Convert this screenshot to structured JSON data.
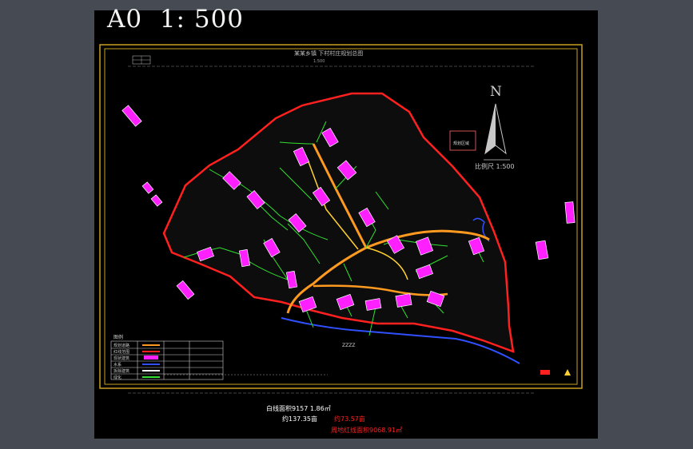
{
  "drawing": {
    "scale_title": "A0  1: 500",
    "plan_title": "某某乡镇 下村村庄规划总图",
    "plan_subtitle": "1:500",
    "north_letter": "N",
    "scale_bar_label": "比例尺 1:500",
    "inset_label": "规划区域",
    "road_label": "ZZZZ",
    "stats": {
      "total_area": "白线面积9157 1.86㎡",
      "total_mu": "约137.35亩",
      "red_mu": "约73.57亩",
      "red_area": "周地红线面积9068.91㎡"
    }
  },
  "colors": {
    "background": "#000000",
    "frame_yellow": "#c8a020",
    "boundary_red": "#ff2020",
    "road_green": "#30e030",
    "road_orange": "#ff9a20",
    "building_magenta": "#ff20ff",
    "water_blue": "#3050ff",
    "title_white": "#f2f2f2"
  },
  "legend": {
    "title": "图例",
    "rows": [
      "规划道路",
      "红线范围",
      "现状建筑",
      "水系",
      "拆除建筑",
      "绿化"
    ]
  }
}
